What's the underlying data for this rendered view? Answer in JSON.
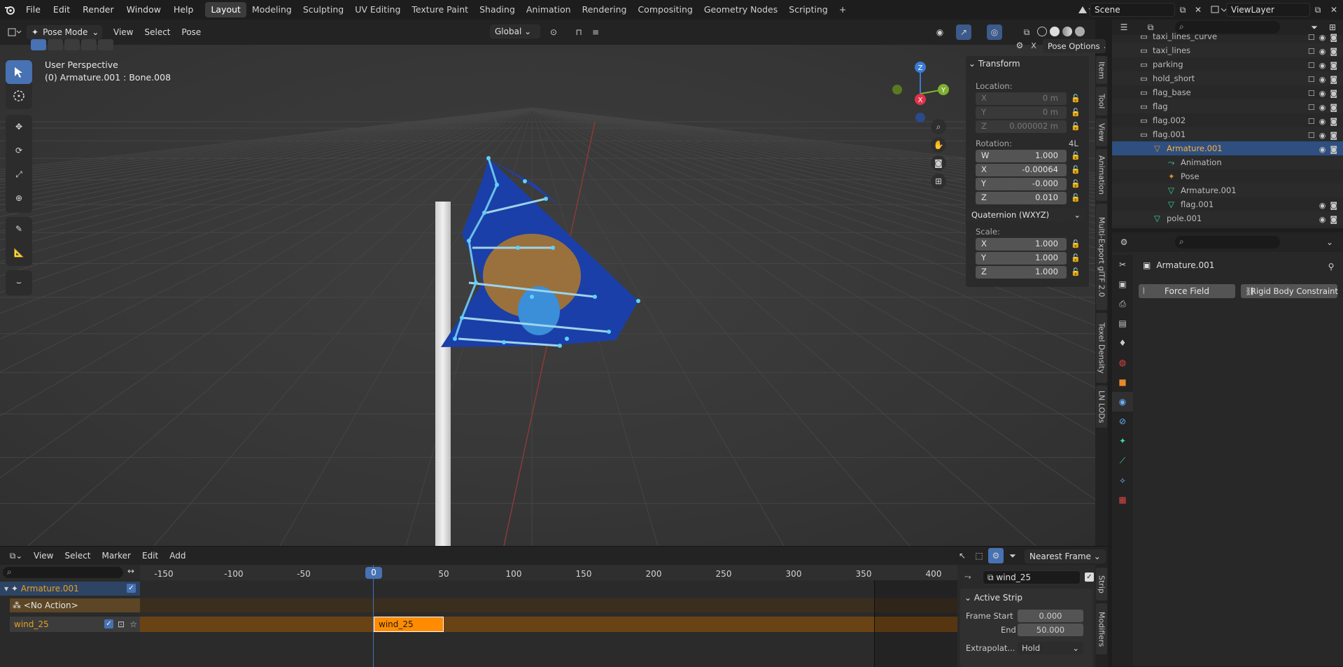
{
  "app": {
    "logo_icon": "blender-logo-icon"
  },
  "menus": [
    "File",
    "Edit",
    "Render",
    "Window",
    "Help"
  ],
  "workspaces": [
    "Layout",
    "Modeling",
    "Sculpting",
    "UV Editing",
    "Texture Paint",
    "Shading",
    "Animation",
    "Rendering",
    "Compositing",
    "Geometry Nodes",
    "Scripting"
  ],
  "active_workspace": "Layout",
  "scene": {
    "name": "Scene",
    "view_layer": "ViewLayer"
  },
  "viewport": {
    "mode": "Pose Mode",
    "menus": [
      "View",
      "Select",
      "Pose"
    ],
    "orientation": "Global",
    "perspective_label": "User Perspective",
    "context_label": "(0) Armature.001 : Bone.008",
    "pose_options": "Pose Options",
    "close_x": "X",
    "gizmo": {
      "z": "Z",
      "y": "Y",
      "x": "X"
    }
  },
  "npanel": {
    "title": "Transform",
    "location_label": "Location:",
    "location": [
      {
        "axis": "X",
        "value": "0 m"
      },
      {
        "axis": "Y",
        "value": "0 m"
      },
      {
        "axis": "Z",
        "value": "0.000002 m"
      }
    ],
    "rotation_label": "Rotation:",
    "rotation_mode_badge": "4L",
    "rotation": [
      {
        "axis": "W",
        "value": "1.000"
      },
      {
        "axis": "X",
        "value": "-0.00064"
      },
      {
        "axis": "Y",
        "value": "-0.000"
      },
      {
        "axis": "Z",
        "value": "0.010"
      }
    ],
    "rotation_mode": "Quaternion (WXYZ)",
    "scale_label": "Scale:",
    "scale": [
      {
        "axis": "X",
        "value": "1.000"
      },
      {
        "axis": "Y",
        "value": "1.000"
      },
      {
        "axis": "Z",
        "value": "1.000"
      }
    ]
  },
  "side_tabs": [
    "Item",
    "Tool",
    "View",
    "Animation",
    "Multi-Export glTF 2.0",
    "Texel Density",
    "LN LODs"
  ],
  "outliner": {
    "rows": [
      {
        "label": "taxi_lines_curve",
        "indent": 1
      },
      {
        "label": "taxi_lines",
        "indent": 1
      },
      {
        "label": "parking",
        "indent": 1
      },
      {
        "label": "hold_short",
        "indent": 1
      },
      {
        "label": "flag_base",
        "indent": 1
      },
      {
        "label": "flag",
        "indent": 1
      },
      {
        "label": "flag.002",
        "indent": 1
      },
      {
        "label": "flag.001",
        "indent": 1
      },
      {
        "label": "Armature.001",
        "indent": 2
      },
      {
        "label": "Animation",
        "indent": 3
      },
      {
        "label": "Pose",
        "indent": 3
      },
      {
        "label": "Armature.001",
        "indent": 3
      },
      {
        "label": "flag.001",
        "indent": 3
      },
      {
        "label": "pole.001",
        "indent": 2
      }
    ]
  },
  "properties": {
    "object_name": "Armature.001",
    "buttons": [
      "Force Field",
      "Rigid Body Constraint"
    ]
  },
  "timeline": {
    "menus": [
      "View",
      "Select",
      "Marker",
      "Edit",
      "Add"
    ],
    "snap": "Nearest Frame",
    "ticks": [
      "-150",
      "-100",
      "-50",
      "0",
      "50",
      "100",
      "150",
      "200",
      "250",
      "300",
      "350",
      "400"
    ],
    "current_frame": "0",
    "tracks": {
      "object": "Armature.001",
      "no_action": "<No Action>",
      "track": "wind_25"
    },
    "strip_label": "wind_25",
    "strip_panel": {
      "action": "wind_25",
      "active_strip": "Active Strip",
      "frame_start_label": "Frame Start",
      "frame_start": "0.000",
      "end_label": "End",
      "end": "50.000",
      "extrapolation_label": "Extrapolat...",
      "extrapolation": "Hold"
    },
    "side_tabs": [
      "Strip",
      "Modifiers"
    ]
  }
}
